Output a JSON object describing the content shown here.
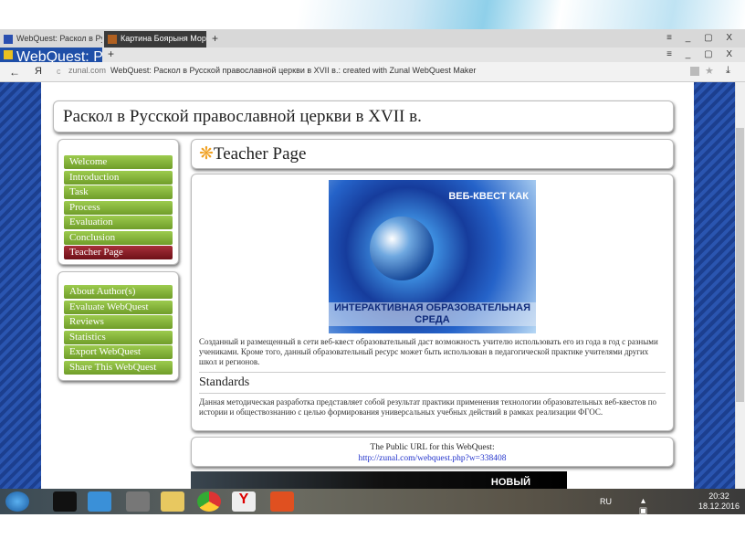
{
  "browser": {
    "tabs_outer": [
      {
        "label": "WebQuest: Раскол в Русско"
      },
      {
        "label": "Картина Боярыня Моро"
      }
    ],
    "tabs_inner": [
      {
        "label": "WebQuest: Раскол в Русс"
      }
    ],
    "new_tab": "+",
    "window_controls": "≡ _ ▢ X",
    "back": "←",
    "yandex": "Я",
    "reload": "c",
    "domain": "zunal.com",
    "page_title": "WebQuest: Раскол в Русской православной церкви в XVII в.: created with Zunal WebQuest Maker",
    "bookmark": "★",
    "download": "⤓"
  },
  "site": {
    "title": "Раскол в Русской православной церкви в XVII в.",
    "nav_main": [
      {
        "label": "Welcome"
      },
      {
        "label": "Introduction"
      },
      {
        "label": "Task"
      },
      {
        "label": "Process"
      },
      {
        "label": "Evaluation"
      },
      {
        "label": "Conclusion"
      },
      {
        "label": "Teacher Page",
        "active": true
      }
    ],
    "nav_extra": [
      {
        "label": "About Author(s)"
      },
      {
        "label": "Evaluate WebQuest"
      },
      {
        "label": "Reviews"
      },
      {
        "label": "Statistics"
      },
      {
        "label": "Export WebQuest"
      },
      {
        "label": "Share This WebQuest"
      }
    ],
    "page_heading": "Teacher Page",
    "image": {
      "top_text": "ВЕБ-КВЕСТ КАК",
      "bottom_text": "ИНТЕРАКТИВНАЯ ОБРАЗОВАТЕЛЬНАЯ СРЕДА"
    },
    "intro_text": "Созданный и размещенный в сети веб-квест образовательный даст возможность учителю использовать его из года в год с разными учениками. Кроме того, данный образовательный ресурс может быть использован в педагогической практике учителями других школ и регионов.",
    "standards_heading": "Standards",
    "standards_text": "Данная методическая разработка представляет собой результат практики применения технологии образовательных веб-квестов по истории и обществознанию с целью формирования универсальных учебных действий в рамках реализации ФГОС.",
    "public_url_label": "The Public URL for this WebQuest:",
    "public_url": "http://zunal.com/webquest.php?w=338408",
    "ad_text": "НОВЫЙ"
  },
  "taskbar": {
    "lang": "RU",
    "time": "20:32",
    "date": "18.12.2016"
  },
  "colors": {
    "nav_green": "#8bbb3f",
    "nav_active": "#8b1c24",
    "tab_active": "#1f4fa8",
    "link": "#2233cc"
  }
}
